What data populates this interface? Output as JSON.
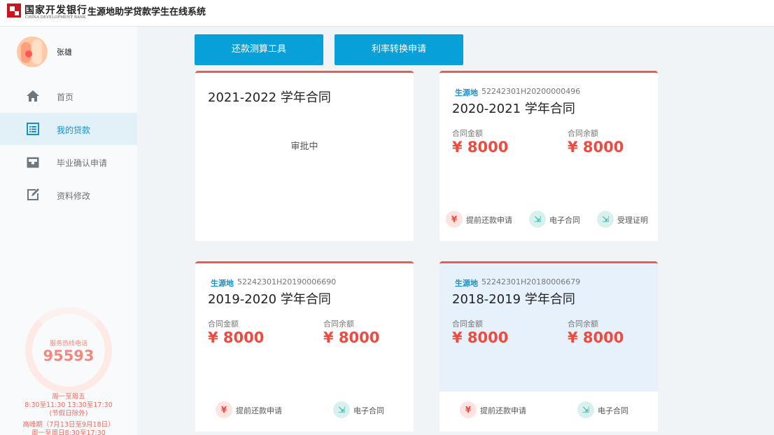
{
  "header": {
    "bank_name_cn": "国家开发银行",
    "bank_name_en": "CHINA DEVELOPMENT BANK",
    "system_title": "生源地助学贷款学生在线系统"
  },
  "user": {
    "name": "张雄"
  },
  "nav": [
    {
      "label": "首页",
      "icon": "home-icon",
      "active": false
    },
    {
      "label": "我的贷款",
      "icon": "list-icon",
      "active": true
    },
    {
      "label": "毕业确认申请",
      "icon": "inbox-icon",
      "active": false
    },
    {
      "label": "资料修改",
      "icon": "edit-icon",
      "active": false
    }
  ],
  "hotline": {
    "label": "服务热线电话",
    "number": "95593",
    "line1": "周一至周五",
    "line2": "8:30至11:30 13:30至17:30",
    "line3": "(节假日除外)",
    "line4": "高峰期（7月13日至9月18日）",
    "line5": "周一至周日8:30至17:30"
  },
  "toolbar": {
    "repay_calc": "还款测算工具",
    "rate_switch": "利率转换申请"
  },
  "labels": {
    "source_tag": "生源地",
    "amount": "合同金额",
    "balance": "合同余额",
    "early_repay": "提前还款申请",
    "e_contract": "电子合同",
    "receipt": "受理证明"
  },
  "contracts": [
    {
      "year": "2021-2022 学年合同",
      "status": "审批中"
    },
    {
      "year": "2020-2021 学年合同",
      "code": "52242301H20200000496",
      "amount": "¥ 8000",
      "balance": "¥ 8000"
    },
    {
      "year": "2019-2020 学年合同",
      "code": "52242301H20190006690",
      "amount": "¥ 8000",
      "balance": "¥ 8000"
    },
    {
      "year": "2018-2019 学年合同",
      "code": "52242301H20180006679",
      "amount": "¥ 8000",
      "balance": "¥ 8000"
    }
  ],
  "colors": {
    "accent": "#08a0d8",
    "card_border": "#ef5a50",
    "amount": "#ef4a3f",
    "source_tag": "#1a8fc9"
  }
}
